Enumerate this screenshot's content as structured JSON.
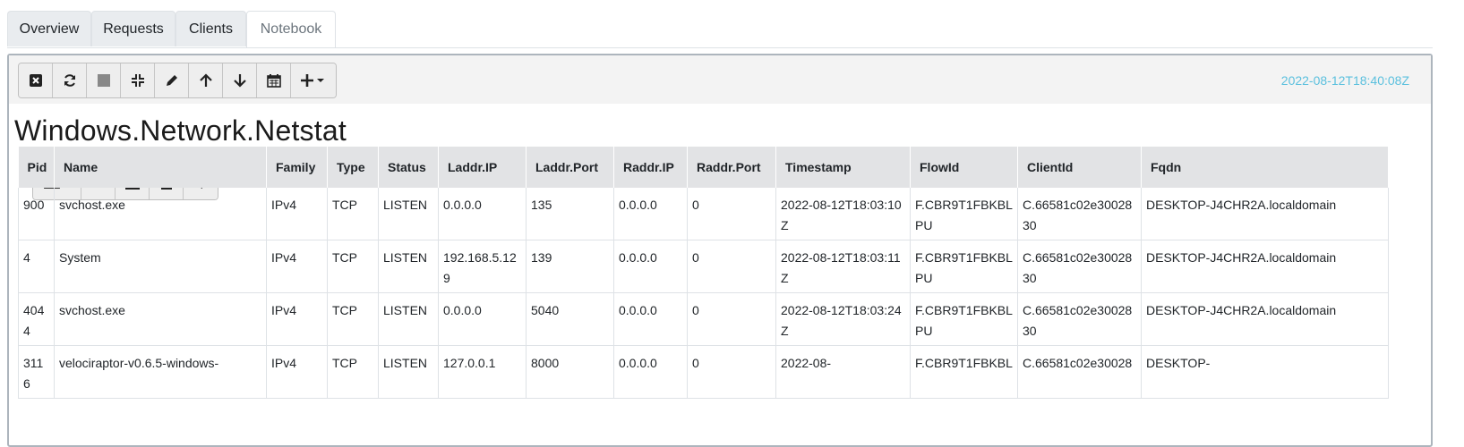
{
  "tabs": [
    {
      "label": "Overview"
    },
    {
      "label": "Requests"
    },
    {
      "label": "Clients"
    },
    {
      "label": "Notebook"
    }
  ],
  "cell": {
    "timestamp": "2022-08-12T18:40:08Z",
    "title": "Windows.Network.Netstat"
  },
  "toolbar_icons": [
    "close-icon",
    "refresh-icon",
    "stop-icon",
    "collapse-icon",
    "edit-icon",
    "arrow-up-icon",
    "arrow-down-icon",
    "calendar-icon",
    "add-cell-icon"
  ],
  "table_icons": [
    "columns-icon",
    "binoculars-icon",
    "download-icon",
    "csv-icon",
    "filter-icon"
  ],
  "table": {
    "columns": [
      "Pid",
      "Name",
      "Family",
      "Type",
      "Status",
      "Laddr.IP",
      "Laddr.Port",
      "Raddr.IP",
      "Raddr.Port",
      "Timestamp",
      "FlowId",
      "ClientId",
      "Fqdn"
    ],
    "rows": [
      [
        "900",
        "svchost.exe",
        "IPv4",
        "TCP",
        "LISTEN",
        "0.0.0.0",
        "135",
        "0.0.0.0",
        "0",
        "2022-08-12T18:03:10Z",
        "F.CBR9T1FBKBLPU",
        "C.66581c02e3002830",
        "DESKTOP-J4CHR2A.localdomain"
      ],
      [
        "4",
        "System",
        "IPv4",
        "TCP",
        "LISTEN",
        "192.168.5.129",
        "139",
        "0.0.0.0",
        "0",
        "2022-08-12T18:03:11Z",
        "F.CBR9T1FBKBLPU",
        "C.66581c02e3002830",
        "DESKTOP-J4CHR2A.localdomain"
      ],
      [
        "4044",
        "svchost.exe",
        "IPv4",
        "TCP",
        "LISTEN",
        "0.0.0.0",
        "5040",
        "0.0.0.0",
        "0",
        "2022-08-12T18:03:24Z",
        "F.CBR9T1FBKBLPU",
        "C.66581c02e3002830",
        "DESKTOP-J4CHR2A.localdomain"
      ],
      [
        "3116",
        "velociraptor-v0.6.5-windows-",
        "IPv4",
        "TCP",
        "LISTEN",
        "127.0.0.1",
        "8000",
        "0.0.0.0",
        "0",
        "2022-08-",
        "F.CBR9T1FBKBL",
        "C.66581c02e30028",
        "DESKTOP-"
      ]
    ]
  }
}
